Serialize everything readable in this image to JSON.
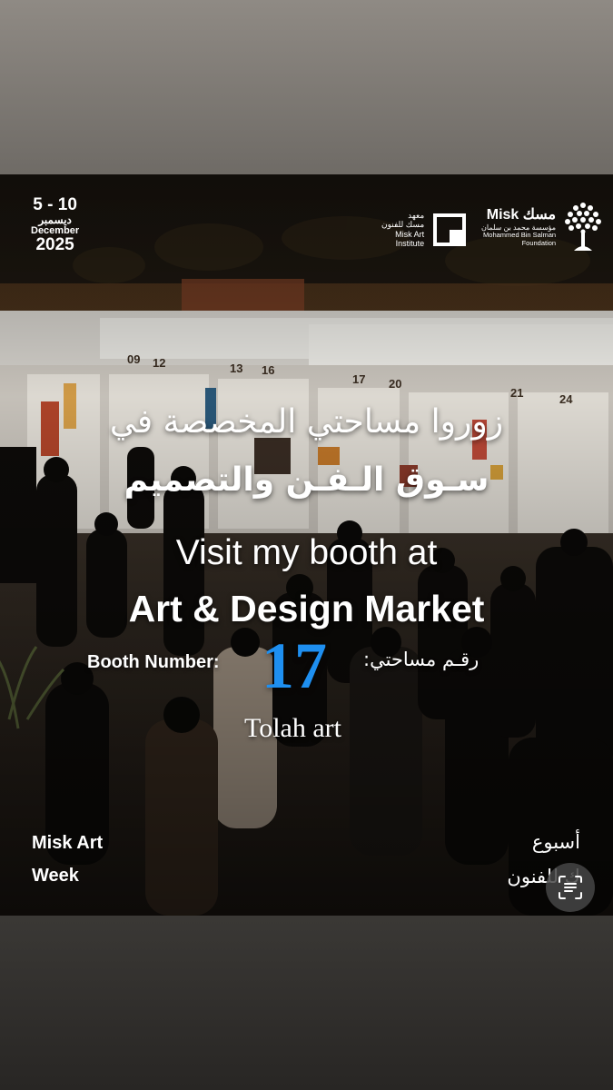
{
  "event_date": {
    "range": "5 - 10",
    "month_ar": "ديسمبر",
    "month_en": "December",
    "year": "2025"
  },
  "logos": {
    "misk_art_institute": {
      "line1_ar": "معهد",
      "line2_ar": "مسك للفنون",
      "line3_en": "Misk Art",
      "line4_en": "Institute"
    },
    "misk_foundation": {
      "name": "Misk مسك",
      "sub_ar": "مؤسسة محمد بن سلمان",
      "sub_en_1": "Mohammed Bin Salman",
      "sub_en_2": "Foundation"
    }
  },
  "headline": {
    "ar_line1": "زوروا مساحتي المخصصة في",
    "ar_line2": "سـوق الـفـن والتصميم",
    "en_line1": "Visit my booth at",
    "en_line2": "Art & Design Market"
  },
  "booth": {
    "label_en": "Booth Number:",
    "number": "17",
    "label_ar": "رقـم مساحتي:"
  },
  "artist": "Tolah art",
  "footer": {
    "en_line1": "Misk Art",
    "en_line2": "Week",
    "ar_line1": "أسبوع",
    "ar_line2": "ك للفنون"
  },
  "booth_signs": [
    "09",
    "12",
    "13",
    "16",
    "17",
    "20",
    "21",
    "24"
  ],
  "colors": {
    "booth_number": "#1e8ff0",
    "text": "#ffffff"
  },
  "icons": {
    "scan_button": "text-scan-icon"
  }
}
